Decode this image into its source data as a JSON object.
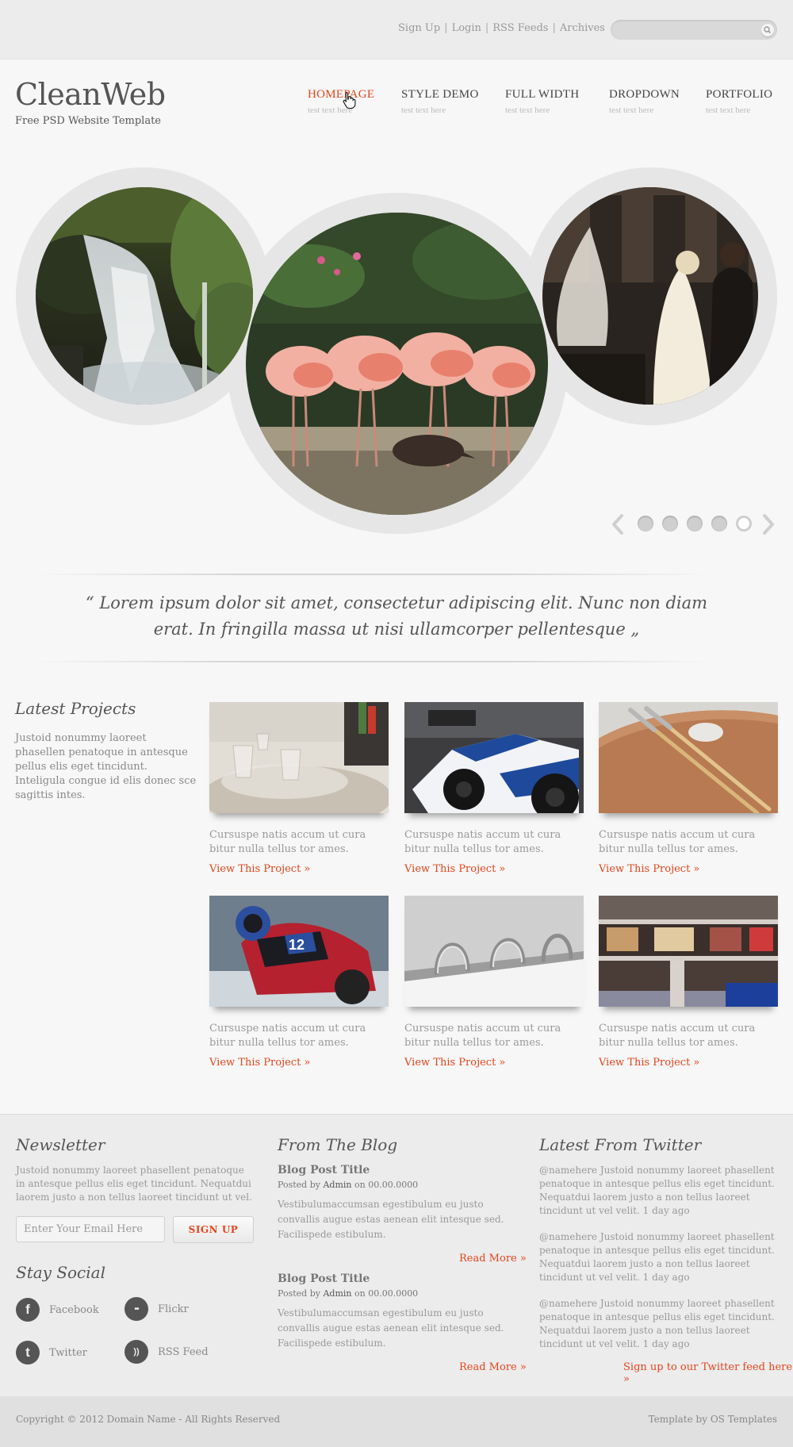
{
  "topbar": {
    "links": [
      "Sign Up",
      "Login",
      "RSS Feeds",
      "Archives"
    ],
    "separator": "|",
    "search_placeholder": ""
  },
  "header": {
    "logo": "CleanWeb",
    "tagline": "Free PSD Website Template"
  },
  "nav": [
    {
      "label": "HOMEPAGE",
      "sub": "test text here"
    },
    {
      "label": "STYLE DEMO",
      "sub": "test text here"
    },
    {
      "label": "FULL WIDTH",
      "sub": "test text here"
    },
    {
      "label": "DROPDOWN",
      "sub": "test text here"
    },
    {
      "label": "PORTFOLIO",
      "sub": "test text here"
    }
  ],
  "slider": {
    "photos": [
      "waterfall",
      "flamingos",
      "wedding couple by fountain"
    ],
    "page_count": 5,
    "current_page": 5
  },
  "quote": "“ Lorem ipsum dolor sit amet, consectetur adipiscing elit. Nunc non diam erat. In fringilla massa ut nisi ullamcorper pellentesque „",
  "projects": {
    "title": "Latest Projects",
    "intro": "Justoid nonummy laoreet phasellen penatoque in antesque pellus elis eget tincidunt. Inteligula congue id elis donec sce sagittis intes.",
    "items": [
      {
        "caption": "Cursuspe natis accum ut cura bitur nulla tellus tor ames.",
        "link": "View This Project »"
      },
      {
        "caption": "Cursuspe natis accum ut cura bitur nulla tellus tor ames.",
        "link": "View This Project »"
      },
      {
        "caption": "Cursuspe natis accum ut cura bitur nulla tellus tor ames.",
        "link": "View This Project »"
      },
      {
        "caption": "Cursuspe natis accum ut cura bitur nulla tellus tor ames.",
        "link": "View This Project »"
      },
      {
        "caption": "Cursuspe natis accum ut cura bitur nulla tellus tor ames.",
        "link": "View This Project »"
      },
      {
        "caption": "Cursuspe natis accum ut cura bitur nulla tellus tor ames.",
        "link": "View This Project »"
      }
    ]
  },
  "newsletter": {
    "title": "Newsletter",
    "text": "Justoid nonummy laoreet phasellent penatoque in antesque pellus elis eget tincidunt. Nequatdui laorem justo a non tellus laoreet tincidunt ut vel.",
    "email_placeholder": "Enter Your Email Here",
    "button": "SIGN UP"
  },
  "social": {
    "title": "Stay Social",
    "items": [
      {
        "label": "Facebook",
        "icon": "facebook-icon",
        "glyph": "f"
      },
      {
        "label": "Flickr",
        "icon": "flickr-icon",
        "glyph": "••"
      },
      {
        "label": "Twitter",
        "icon": "twitter-icon",
        "glyph": "t"
      },
      {
        "label": "RSS Feed",
        "icon": "rss-icon",
        "glyph": "))"
      }
    ]
  },
  "blog": {
    "title": "From The Blog",
    "posts": [
      {
        "title": "Blog Post Title",
        "posted_by": "Posted by",
        "author": "Admin",
        "on": "on",
        "date": "00.00.0000",
        "excerpt": "Vestibulumaccumsan egestibulum eu justo convallis augue estas aenean elit intesque sed. Facilispede estibulum.",
        "more": "Read More »"
      },
      {
        "title": "Blog Post Title",
        "posted_by": "Posted by",
        "author": "Admin",
        "on": "on",
        "date": "00.00.0000",
        "excerpt": "Vestibulumaccumsan egestibulum eu justo convallis augue estas aenean elit intesque sed. Facilispede estibulum.",
        "more": "Read More »"
      }
    ]
  },
  "twitter": {
    "title": "Latest From Twitter",
    "tweets": [
      {
        "text": "@namehere Justoid nonummy laoreet phasellent penatoque in antesque pellus elis eget tincidunt. Nequatdui laorem justo a non tellus laoreet tincidunt ut vel velit.",
        "time": "1 day ago"
      },
      {
        "text": "@namehere Justoid nonummy laoreet phasellent penatoque in antesque pellus elis eget tincidunt. Nequatdui laorem justo a non tellus laoreet tincidunt ut vel velit.",
        "time": "1 day ago"
      },
      {
        "text": "@namehere Justoid nonummy laoreet phasellent penatoque in antesque pellus elis eget tincidunt. Nequatdui laorem justo a non tellus laoreet tincidunt ut vel velit.",
        "time": "1 day ago"
      }
    ],
    "follow": "Sign up to our Twitter feed here »"
  },
  "footer": {
    "copyright": "Copyright © 2012 Domain Name - All Rights Reserved",
    "credit": "Template by OS Templates"
  },
  "colors": {
    "accent": "#e5451c",
    "text": "#777777",
    "heading": "#555555",
    "background": "#f7f7f7",
    "footer_bg": "#ececec"
  }
}
